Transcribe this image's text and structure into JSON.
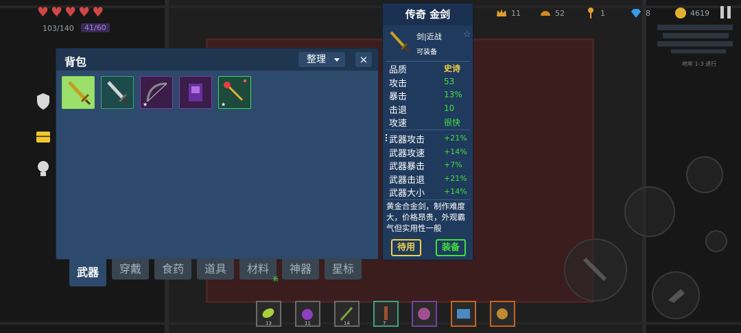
{
  "hud": {
    "hp": "103/140",
    "mana": "41/60",
    "resources": [
      {
        "icon": "rank-crown-icon",
        "value": "11"
      },
      {
        "icon": "speed-gauge-icon",
        "value": "52"
      },
      {
        "icon": "key-icon",
        "value": "1"
      },
      {
        "icon": "gem-icon",
        "value": "8"
      },
      {
        "icon": "coin-icon",
        "value": "4619"
      }
    ],
    "minimap_label": "地牢 1-3 进行"
  },
  "bag": {
    "title": "背包",
    "sort_label": "整理",
    "close_label": "×",
    "items": [
      {
        "name": "gold-sword",
        "rarity": "legendary",
        "border": "#7ed957",
        "bg": "#9be06a",
        "starred": false
      },
      {
        "name": "iron-sword",
        "rarity": "rare",
        "border": "#3fa37a",
        "bg": "#1d4a4a",
        "starred": false
      },
      {
        "name": "bow",
        "rarity": "epic",
        "border": "#7b3fa3",
        "bg": "#3b1d4a",
        "starred": true
      },
      {
        "name": "spellbook",
        "rarity": "epic",
        "border": "#7b3fa3",
        "bg": "#3b1d4a",
        "starred": false
      },
      {
        "name": "magic-staff",
        "rarity": "rare",
        "border": "#3fd96a",
        "bg": "#1d4a3a",
        "starred": true
      }
    ]
  },
  "tabs": [
    {
      "label": "武器",
      "active": true
    },
    {
      "label": "穿戴",
      "active": false
    },
    {
      "label": "食药",
      "active": false
    },
    {
      "label": "道具",
      "active": false
    },
    {
      "label": "材料",
      "active": false
    },
    {
      "label": "神器",
      "active": false
    },
    {
      "label": "星标",
      "active": false
    }
  ],
  "tab_new_badge": "新",
  "detail": {
    "title": "传奇 金剑",
    "type": "剑|近战",
    "equip_status": "可装备",
    "stats": [
      {
        "label": "品质",
        "value": "史诗",
        "gold": true
      },
      {
        "label": "攻击",
        "value": "53",
        "gold": false
      },
      {
        "label": "暴击",
        "value": "13%",
        "gold": false
      },
      {
        "label": "击退",
        "value": "10",
        "gold": false
      },
      {
        "label": "攻速",
        "value": "很快",
        "gold": false
      }
    ],
    "bonuses": [
      {
        "label": "武器攻击",
        "value": "+21%"
      },
      {
        "label": "武器攻速",
        "value": "+14%"
      },
      {
        "label": "武器暴击",
        "value": "+7%"
      },
      {
        "label": "武器击退",
        "value": "+21%"
      },
      {
        "label": "武器大小",
        "value": "+14%"
      }
    ],
    "description": "黄金合金剑，制作难度大，价格昂贵，外观霸气但实用性一般",
    "wait_label": "待用",
    "equip_label": "装备"
  },
  "quickbar": [
    {
      "icon": "leaf-icon",
      "count": "13",
      "border": "#6b6b6b"
    },
    {
      "icon": "potion-icon",
      "count": "11",
      "border": "#6b6b6b"
    },
    {
      "icon": "herb-icon",
      "count": "14",
      "border": "#6b6b6b"
    },
    {
      "icon": "torch-icon",
      "count": "7",
      "border": "#3fa37a"
    },
    {
      "icon": "orb-icon",
      "count": "",
      "border": "#7b3fa3"
    },
    {
      "icon": "chest-icon",
      "count": "",
      "border": "#c8641e"
    },
    {
      "icon": "relic-icon",
      "count": "",
      "border": "#c8641e"
    }
  ],
  "colors": {
    "legendary": "#f0d14a",
    "stat_green": "#43e03f",
    "panel": "#2d4a6c"
  }
}
